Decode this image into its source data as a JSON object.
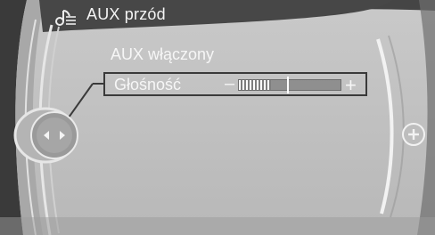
{
  "header": {
    "title": "AUX przód",
    "icon": "music-note-settings-icon"
  },
  "menu": {
    "items": [
      {
        "label": "AUX włączony"
      },
      {
        "label": "Głośność"
      }
    ],
    "volume": {
      "minus": "–",
      "plus": "+",
      "level": 0.32
    }
  },
  "controller": {
    "left_icon": "controller-knob-icon",
    "right_icon": "plus-icon"
  }
}
